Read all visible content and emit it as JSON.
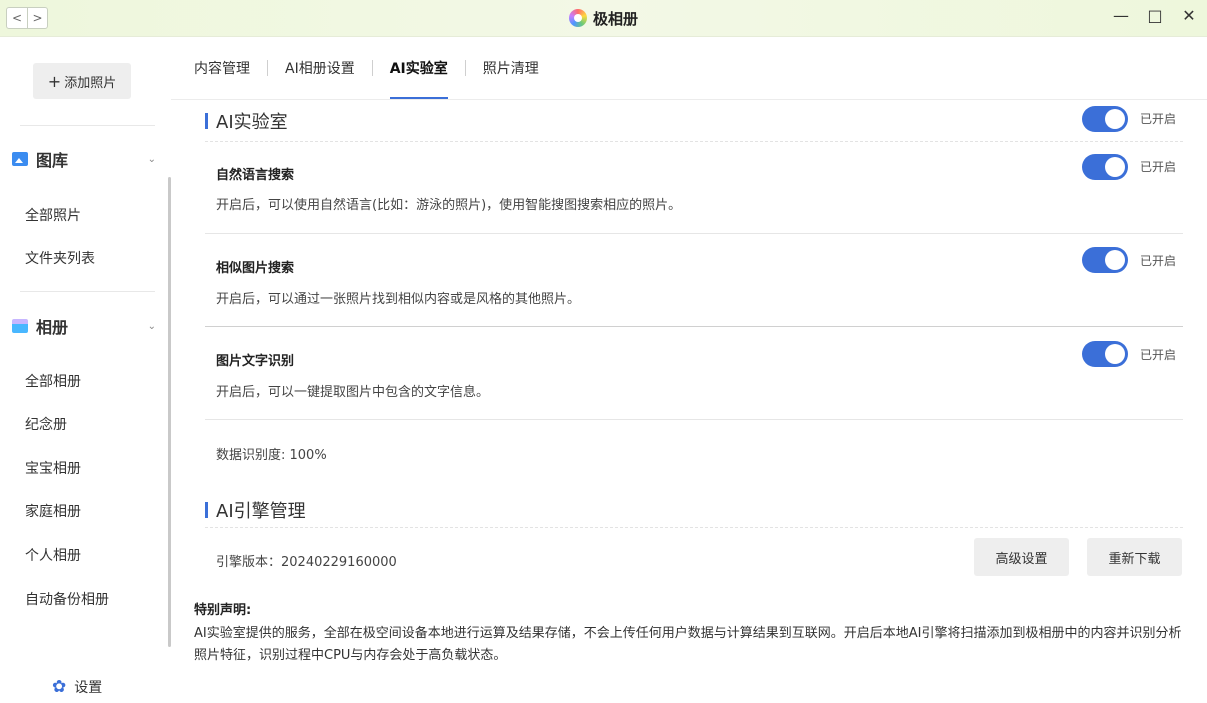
{
  "window": {
    "title": "极相册",
    "nav_back": "<",
    "nav_forward": ">",
    "minimize": "—",
    "maximize": "□",
    "close": "✕"
  },
  "sidebar": {
    "add_photo": "添加照片",
    "gallery_header": "图库",
    "gallery_items": [
      "全部照片",
      "文件夹列表"
    ],
    "album_header": "相册",
    "album_items": [
      "全部相册",
      "纪念册",
      "宝宝相册",
      "家庭相册",
      "个人相册",
      "自动备份相册"
    ],
    "settings": "设置"
  },
  "tabs": [
    {
      "label": "内容管理",
      "active": false
    },
    {
      "label": "AI相册设置",
      "active": false
    },
    {
      "label": "AI实验室",
      "active": true
    },
    {
      "label": "照片清理",
      "active": false
    }
  ],
  "ai_lab": {
    "title": "AI实验室",
    "status": "已开启",
    "features": [
      {
        "title": "自然语言搜索",
        "desc": "开启后，可以使用自然语言(比如：游泳的照片)，使用智能搜图搜索相应的照片。",
        "status": "已开启"
      },
      {
        "title": "相似图片搜索",
        "desc": "开启后，可以通过一张照片找到相似内容或是风格的其他照片。",
        "status": "已开启"
      },
      {
        "title": "图片文字识别",
        "desc": "开启后，可以一键提取图片中包含的文字信息。",
        "status": "已开启"
      }
    ],
    "recognition": "数据识别度: 100%"
  },
  "engine": {
    "title": "AI引擎管理",
    "version": "引擎版本：20240229160000",
    "advanced_button": "高级设置",
    "redownload_button": "重新下载"
  },
  "notice": {
    "title": "特别声明:",
    "text": "AI实验室提供的服务，全部在极空间设备本地进行运算及结果存储，不会上传任何用户数据与计算结果到互联网。开启后本地AI引擎将扫描添加到极相册中的内容并识别分析照片特征，识别过程中CPU与内存会处于高负载状态。"
  },
  "colors": {
    "accent": "#3b6fd8",
    "titlebar_bg": "#eef7dc"
  }
}
